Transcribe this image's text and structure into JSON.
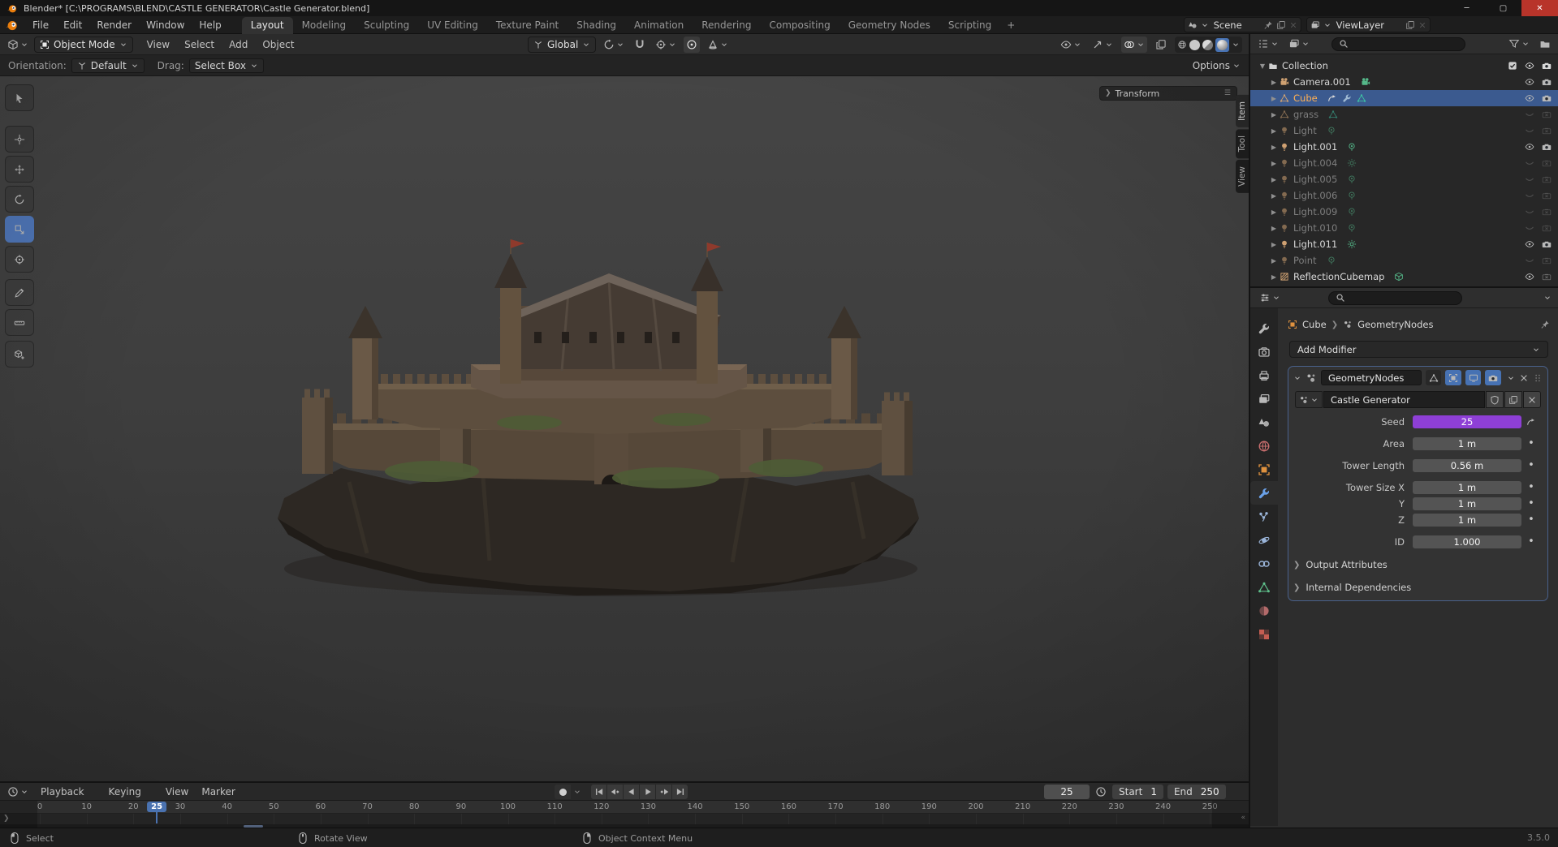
{
  "window": {
    "title": "Blender* [C:\\PROGRAMS\\BLEND\\CASTLE GENERATOR\\Castle Generator.blend]",
    "controls": [
      "minimize",
      "maximize",
      "close"
    ]
  },
  "topbar": {
    "menus": [
      "File",
      "Edit",
      "Render",
      "Window",
      "Help"
    ],
    "workspaces": [
      "Layout",
      "Modeling",
      "Sculpting",
      "UV Editing",
      "Texture Paint",
      "Shading",
      "Animation",
      "Rendering",
      "Compositing",
      "Geometry Nodes",
      "Scripting"
    ],
    "active_workspace": "Layout",
    "add_workspace_label": "+",
    "scene_name": "Scene",
    "view_layer_name": "ViewLayer"
  },
  "viewport": {
    "mode": "Object Mode",
    "menus": [
      "View",
      "Select",
      "Add",
      "Object"
    ],
    "orientation_value": "Global",
    "tool_settings": {
      "orientation_label": "Orientation:",
      "orientation_value": "Default",
      "drag_label": "Drag:",
      "drag_value": "Select Box",
      "options_label": "Options"
    },
    "transform_panel_label": "Transform",
    "sidebar_tabs": [
      "Item",
      "Tool",
      "View"
    ],
    "toolbar": [
      {
        "icon": "select-box-icon"
      },
      {
        "icon": "cursor-icon"
      },
      {
        "icon": "move-icon"
      },
      {
        "icon": "rotate-icon"
      },
      {
        "icon": "scale-icon",
        "active": true
      },
      {
        "icon": "transform-icon"
      },
      {
        "icon": "annotate-icon"
      },
      {
        "icon": "measure-icon"
      },
      {
        "icon": "add-cube-icon"
      }
    ],
    "shading_modes": [
      {
        "icon": "wireframe-icon"
      },
      {
        "icon": "solid-icon"
      },
      {
        "icon": "material-preview-icon"
      },
      {
        "icon": "rendered-icon",
        "active": true
      }
    ]
  },
  "outliner": {
    "collection_label": "Collection",
    "rows": [
      {
        "label": "Camera.001",
        "icon": "camera-icon",
        "badges": [
          "camera-data-icon"
        ],
        "dim": false,
        "selected": false,
        "eye": true,
        "render": true
      },
      {
        "label": "Cube",
        "icon": "mesh-icon",
        "badges": [
          "driver-icon",
          "wrench-icon",
          "mesh-data-icon"
        ],
        "dim": false,
        "selected": true,
        "eye": true,
        "render": true
      },
      {
        "label": "grass",
        "icon": "mesh-icon",
        "badges": [
          "mesh-data-icon"
        ],
        "dim": true,
        "selected": false,
        "eye": false,
        "render": false
      },
      {
        "label": "Light",
        "icon": "light-icon",
        "badges": [
          "point-light-icon"
        ],
        "dim": true,
        "selected": false,
        "eye": false,
        "render": false
      },
      {
        "label": "Light.001",
        "icon": "light-icon",
        "badges": [
          "point-light-icon"
        ],
        "dim": false,
        "selected": false,
        "eye": true,
        "render": true
      },
      {
        "label": "Light.004",
        "icon": "light-icon",
        "badges": [
          "sun-icon"
        ],
        "dim": true,
        "selected": false,
        "eye": false,
        "render": false
      },
      {
        "label": "Light.005",
        "icon": "light-icon",
        "badges": [
          "point-light-icon"
        ],
        "dim": true,
        "selected": false,
        "eye": false,
        "render": false
      },
      {
        "label": "Light.006",
        "icon": "light-icon",
        "badges": [
          "point-light-icon"
        ],
        "dim": true,
        "selected": false,
        "eye": false,
        "render": false
      },
      {
        "label": "Light.009",
        "icon": "light-icon",
        "badges": [
          "point-light-icon"
        ],
        "dim": true,
        "selected": false,
        "eye": false,
        "render": false
      },
      {
        "label": "Light.010",
        "icon": "light-icon",
        "badges": [
          "point-light-icon"
        ],
        "dim": true,
        "selected": false,
        "eye": false,
        "render": false
      },
      {
        "label": "Light.011",
        "icon": "light-icon",
        "badges": [
          "sun-icon"
        ],
        "dim": false,
        "selected": false,
        "eye": true,
        "render": true
      },
      {
        "label": "Point",
        "icon": "light-icon",
        "badges": [
          "point-light-icon"
        ],
        "dim": true,
        "selected": false,
        "eye": false,
        "render": false
      },
      {
        "label": "ReflectionCubemap",
        "icon": "probe-icon",
        "badges": [
          "cube-icon"
        ],
        "dim": false,
        "selected": false,
        "eye": true,
        "render": false
      }
    ]
  },
  "properties": {
    "tabs": [
      {
        "icon": "tool-icon"
      },
      {
        "icon": "render-icon"
      },
      {
        "icon": "output-icon"
      },
      {
        "icon": "view-layer-icon"
      },
      {
        "icon": "scene-icon"
      },
      {
        "icon": "world-icon"
      },
      {
        "icon": "object-icon"
      },
      {
        "icon": "modifiers-icon",
        "active": true
      },
      {
        "icon": "particles-icon"
      },
      {
        "icon": "physics-icon"
      },
      {
        "icon": "constraints-icon"
      },
      {
        "icon": "data-icon"
      },
      {
        "icon": "material-icon"
      },
      {
        "icon": "texture-icon"
      }
    ],
    "breadcrumb": {
      "object": "Cube",
      "modifier": "GeometryNodes"
    },
    "add_modifier_label": "Add Modifier",
    "modifier": {
      "name": "GeometryNodes",
      "node_group": "Castle Generator",
      "fields": [
        {
          "label": "Seed",
          "value": "25",
          "purple": true,
          "right": "driver",
          "gap": false
        },
        {
          "label": "Area",
          "value": "1 m",
          "right": "dot",
          "gap": true
        },
        {
          "label": "Tower Length",
          "value": "0.56 m",
          "right": "dot",
          "gap": true
        },
        {
          "label": "Tower Size X",
          "value": "1 m",
          "right": "dot",
          "gap": true
        },
        {
          "label": "Y",
          "value": "1 m",
          "right": "dot",
          "gap": false
        },
        {
          "label": "Z",
          "value": "1 m",
          "right": "dot",
          "gap": false
        },
        {
          "label": "ID",
          "value": "1.000",
          "right": "dot",
          "gap": true
        }
      ],
      "sections": [
        "Output Attributes",
        "Internal Dependencies"
      ]
    }
  },
  "timeline": {
    "menus": [
      {
        "label": "Playback",
        "dropdown": true
      },
      {
        "label": "Keying",
        "dropdown": true
      },
      {
        "label": "View",
        "dropdown": false
      },
      {
        "label": "Marker",
        "dropdown": false
      }
    ],
    "transport": [
      {
        "icon": "jump-start-icon"
      },
      {
        "icon": "prev-keyframe-icon"
      },
      {
        "icon": "play-reverse-icon"
      },
      {
        "icon": "play-icon"
      },
      {
        "icon": "next-keyframe-icon"
      },
      {
        "icon": "jump-end-icon"
      }
    ],
    "current_frame": "25",
    "start_label": "Start",
    "start_value": "1",
    "end_label": "End",
    "end_value": "250",
    "ticks": [
      0,
      10,
      20,
      30,
      40,
      50,
      60,
      70,
      80,
      90,
      100,
      110,
      120,
      130,
      140,
      150,
      160,
      170,
      180,
      190,
      200,
      210,
      220,
      230,
      240,
      250
    ]
  },
  "status_bar": {
    "hints": [
      {
        "icon": "mouse-left-icon",
        "label": "Select"
      },
      {
        "icon": "mouse-middle-icon",
        "label": "Rotate View"
      },
      {
        "icon": "mouse-right-icon",
        "label": "Object Context Menu"
      }
    ],
    "version": "3.5.0"
  },
  "colors": {
    "accent_blue": "#4772b3",
    "driver_purple": "#8e3fd6",
    "selected_row": "#3b5a8f",
    "active_object_text": "#ffb054",
    "blender_orange": "#e87d0d"
  }
}
